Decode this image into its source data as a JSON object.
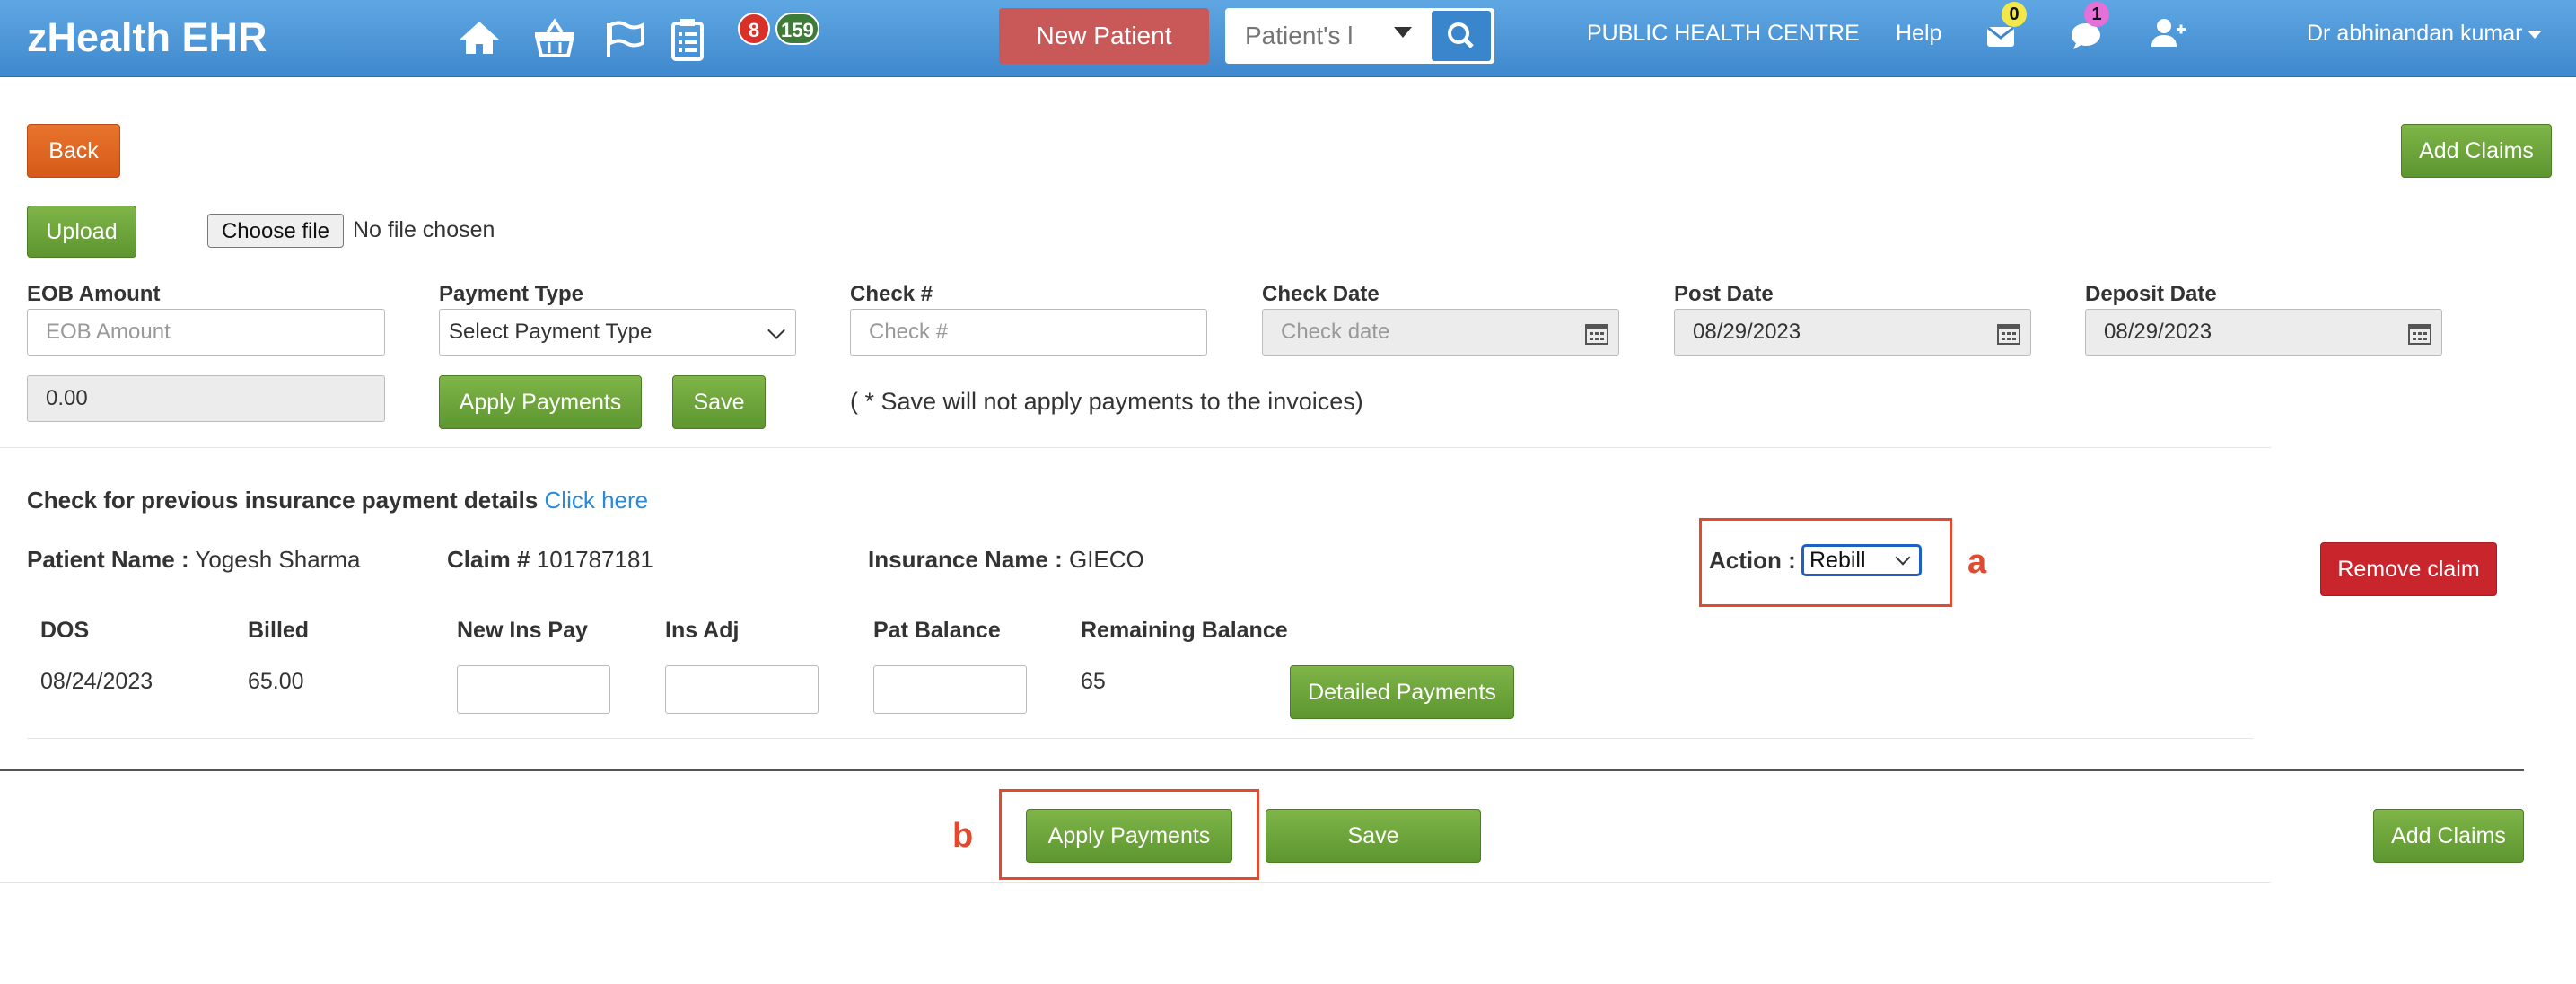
{
  "navbar": {
    "brand": "zHealth EHR",
    "icons": [
      "home-icon",
      "basket-icon",
      "flag-icon",
      "clipboard-icon"
    ],
    "badge_red": "8",
    "badge_green": "159",
    "new_patient_label": "New Patient",
    "search_placeholder": "Patient's l",
    "facility": "PUBLIC HEALTH CENTRE",
    "help": "Help",
    "mail_count": "0",
    "chat_count": "1",
    "user": "Dr abhinandan kumar"
  },
  "toolbar": {
    "back_label": "Back",
    "add_claims_label": "Add Claims",
    "upload_label": "Upload",
    "choose_file_label": "Choose file",
    "no_file_text": "No file chosen"
  },
  "form": {
    "eob_amount_label": "EOB Amount",
    "eob_amount_placeholder": "EOB Amount",
    "payment_type_label": "Payment Type",
    "payment_type_value": "Select Payment Type",
    "check_no_label": "Check #",
    "check_no_placeholder": "Check #",
    "check_date_label": "Check Date",
    "check_date_placeholder": "Check date",
    "post_date_label": "Post Date",
    "post_date_value": "08/29/2023",
    "deposit_date_label": "Deposit Date",
    "deposit_date_value": "08/29/2023",
    "total_value": "0.00",
    "apply_payments_label": "Apply Payments",
    "save_label": "Save",
    "save_note": "( * Save will not apply payments to the invoices)"
  },
  "claim": {
    "previous_text": "Check for previous insurance payment details",
    "click_here": "Click here",
    "patient_name_label": "Patient Name :",
    "patient_name": "Yogesh Sharma",
    "claim_label": "Claim #",
    "claim_number": "101787181",
    "insurance_label": "Insurance Name :",
    "insurance_name": "GIECO",
    "action_label": "Action :",
    "action_value": "Rebill",
    "remove_claim_label": "Remove claim",
    "columns": [
      "DOS",
      "Billed",
      "New Ins Pay",
      "Ins Adj",
      "Pat Balance",
      "Remaining Balance"
    ],
    "row": {
      "dos": "08/24/2023",
      "billed": "65.00",
      "remaining": "65"
    },
    "detailed_payments_label": "Detailed Payments"
  },
  "footer": {
    "apply_payments_label": "Apply Payments",
    "save_label": "Save",
    "add_claims_label": "Add Claims"
  },
  "annotations": {
    "a": "a",
    "b": "b",
    "color": "#e04a2f"
  }
}
